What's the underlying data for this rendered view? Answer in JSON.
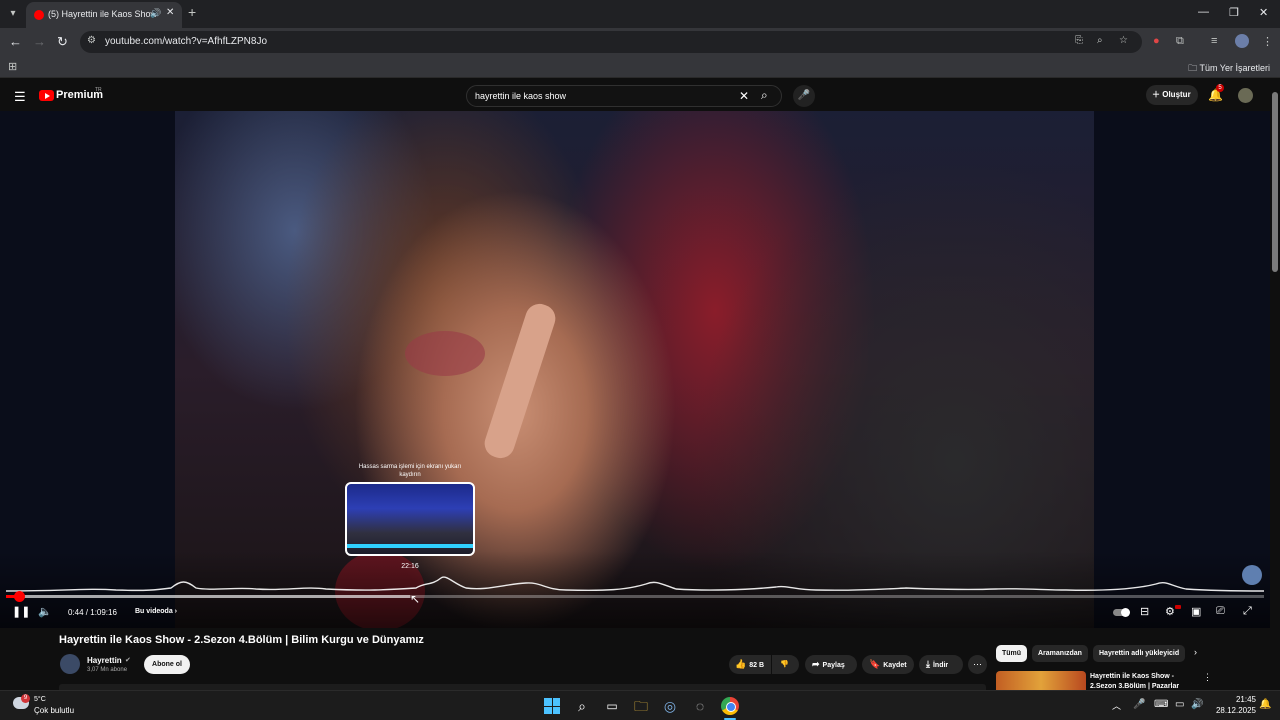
{
  "browser": {
    "tab_title": "(5) Hayrettin ile Kaos Show",
    "tab_audio_icon": "speaker-icon",
    "url": "youtube.com/watch?v=AfhfLZPN8Jo",
    "bookmarks_all": "Tüm Yer İşaretleri",
    "window_controls": [
      "minimize",
      "restore",
      "close"
    ]
  },
  "youtube": {
    "logo_text": "Premium",
    "logo_region": "TR",
    "search_query": "hayrettin ile kaos show",
    "create_label": "Oluştur",
    "notification_count": "5"
  },
  "player": {
    "current_time": "0:44",
    "duration": "1:09:16",
    "time_display": "0:44 / 1:09:16",
    "chapter_label": "Bu videoda",
    "preview_hint": "Hassas sarma işlemi için ekranı yukarı kaydırın",
    "preview_time": "22:16",
    "played_fraction": 0.0106,
    "hover_fraction": 0.3215
  },
  "video": {
    "title": "Hayrettin ile Kaos Show - 2.Sezon 4.Bölüm | Bilim Kurgu ve Dünyamız",
    "channel_name": "Hayrettin",
    "subscribers": "3,07 Mn abone",
    "subscribe_label": "Abone ol",
    "like_count": "82 B",
    "share_label": "Paylaş",
    "save_label": "Kaydet",
    "download_label": "İndir"
  },
  "sidebar": {
    "chips": [
      "Tümü",
      "Aramanızdan",
      "Hayrettin adlı yükleyicid"
    ],
    "recommended_title": "Hayrettin ile Kaos Show - 2.Sezon 3.Bölüm | Pazarlar"
  },
  "taskbar": {
    "weather_temp": "5°C",
    "weather_desc": "Çok bulutlu",
    "weather_badge": "9",
    "clock_time": "21:45",
    "clock_date": "28.12.2025"
  },
  "colors": {
    "youtube_red": "#ff0000",
    "windows_accent": "#4cc2ff"
  }
}
